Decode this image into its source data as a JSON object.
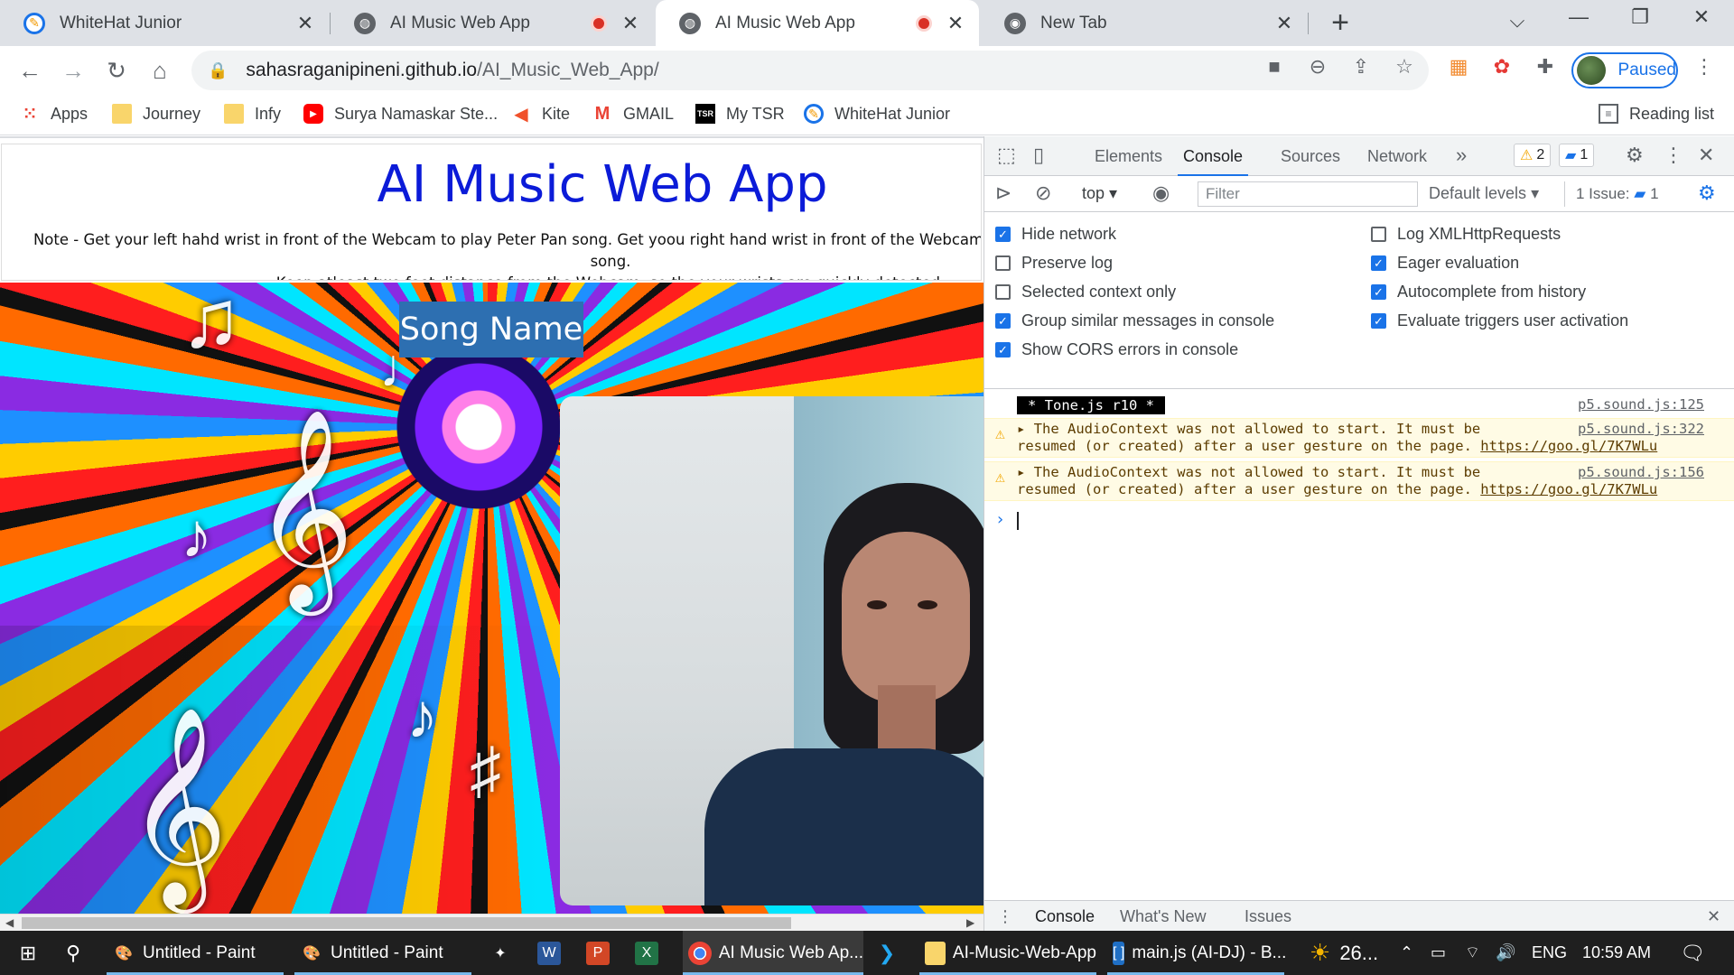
{
  "tabs": [
    {
      "title": "WhiteHat Junior",
      "recording": false
    },
    {
      "title": "AI Music Web App",
      "recording": true
    },
    {
      "title": "AI Music Web App",
      "recording": true
    },
    {
      "title": "New Tab",
      "recording": false
    }
  ],
  "address": {
    "host": "sahasraganipineni.github.io",
    "path": "/AI_Music_Web_App/"
  },
  "profile": {
    "label": "Paused"
  },
  "bookmarks": [
    {
      "label": "Apps"
    },
    {
      "label": "Journey"
    },
    {
      "label": "Infy"
    },
    {
      "label": "Surya Namaskar Ste..."
    },
    {
      "label": "Kite"
    },
    {
      "label": "GMAIL"
    },
    {
      "label": "My TSR"
    },
    {
      "label": "WhiteHat Junior"
    }
  ],
  "reading_list": "Reading list",
  "page": {
    "title": "AI Music Web App",
    "note_line1": "Note - Get your left hahd wrist in front of the Webcam to play Peter Pan song. Get yoou right hand wrist in front of the Webcam to play Harry Potter theme song.",
    "note_line2": "Keep atleast two feet distance from the Webcam, so the your wrists are quickly detected.",
    "song_name": "Song Name"
  },
  "devtools": {
    "tabs": [
      "Elements",
      "Console",
      "Sources",
      "Network"
    ],
    "warnings_count": "2",
    "messages_count": "1",
    "context": "top",
    "filter_placeholder": "Filter",
    "levels": "Default levels",
    "issues_label": "1 Issue:",
    "issues_count": "1",
    "settings_left": [
      {
        "label": "Hide network",
        "checked": true
      },
      {
        "label": "Preserve log",
        "checked": false
      },
      {
        "label": "Selected context only",
        "checked": false
      },
      {
        "label": "Group similar messages in console",
        "checked": true
      },
      {
        "label": "Show CORS errors in console",
        "checked": true
      }
    ],
    "settings_right": [
      {
        "label": "Log XMLHttpRequests",
        "checked": false
      },
      {
        "label": "Eager evaluation",
        "checked": true
      },
      {
        "label": "Autocomplete from history",
        "checked": true
      },
      {
        "label": "Evaluate triggers user activation",
        "checked": true
      }
    ],
    "console": {
      "tone": " * Tone.js r10 * ",
      "tone_src": "p5.sound.js:125",
      "warnings": [
        {
          "line1": "The AudioContext was not allowed to start. It must be",
          "line2": "resumed (or created) after a user gesture on the page.",
          "link": "https://goo.gl/7K7WLu",
          "src": "p5.sound.js:322"
        },
        {
          "line1": "The AudioContext was not allowed to start. It must be",
          "line2": "resumed (or created) after a user gesture on the page.",
          "link": "https://goo.gl/7K7WLu",
          "src": "p5.sound.js:156"
        }
      ]
    },
    "drawer_tabs": [
      "Console",
      "What's New",
      "Issues"
    ]
  },
  "taskbar": {
    "items": [
      {
        "label": "Untitled - Paint"
      },
      {
        "label": "Untitled - Paint"
      },
      {
        "label": "AI Music Web Ap..."
      },
      {
        "label": "AI-Music-Web-App"
      },
      {
        "label": "main.js (AI-DJ) - B..."
      }
    ],
    "weather": "26...",
    "lang": "ENG",
    "time": "10:59 AM"
  },
  "colors": {
    "accent": "#1a73e8",
    "title_blue": "#0b1bd8",
    "song_box": "#2d6fb1"
  }
}
